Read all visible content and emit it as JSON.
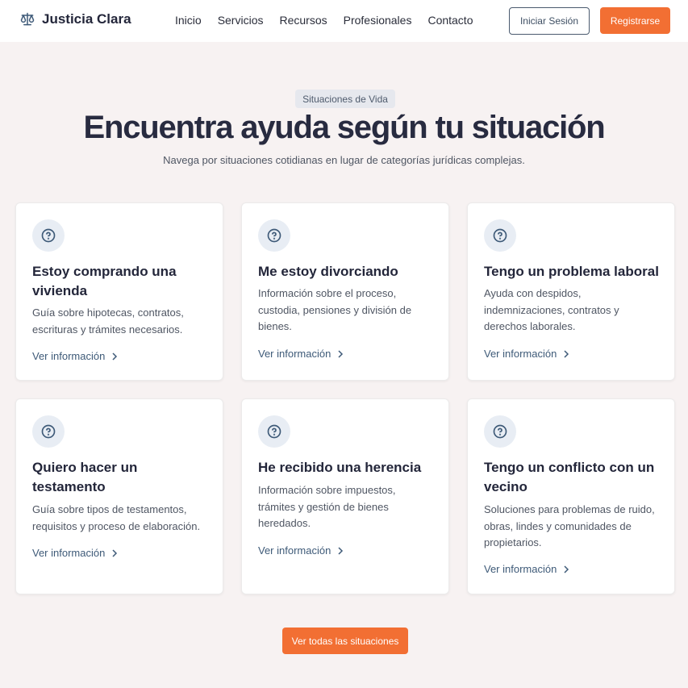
{
  "header": {
    "brand": "Justicia Clara",
    "brand_icon": "scales-icon",
    "nav": [
      "Inicio",
      "Servicios",
      "Recursos",
      "Profesionales",
      "Contacto"
    ],
    "login_label": "Iniciar Sesión",
    "register_label": "Registrarse"
  },
  "hero": {
    "badge": "Situaciones de Vida",
    "title": "Encuentra ayuda según tu situación",
    "subtitle": "Navega por situaciones cotidianas en lugar de categorías jurídicas complejas."
  },
  "cards": [
    {
      "icon": "question-circle-icon",
      "title": "Estoy comprando una vivienda",
      "description": "Guía sobre hipotecas, contratos, escrituras y trámites necesarios.",
      "link": "Ver información"
    },
    {
      "icon": "question-circle-icon",
      "title": "Me estoy divorciando",
      "description": "Información sobre el proceso, custodia, pensiones y división de bienes.",
      "link": "Ver información"
    },
    {
      "icon": "question-circle-icon",
      "title": "Tengo un problema laboral",
      "description": "Ayuda con despidos, indemnizaciones, contratos y derechos laborales.",
      "link": "Ver información"
    },
    {
      "icon": "question-circle-icon",
      "title": "Quiero hacer un testamento",
      "description": "Guía sobre tipos de testamentos, requisitos y proceso de elaboración.",
      "link": "Ver información"
    },
    {
      "icon": "question-circle-icon",
      "title": "He recibido una herencia",
      "description": "Información sobre impuestos, trámites y gestión de bienes heredados.",
      "link": "Ver información"
    },
    {
      "icon": "question-circle-icon",
      "title": "Tengo un conflicto con un vecino",
      "description": "Soluciones para problemas de ruido, obras, lindes y comunidades de propietarios.",
      "link": "Ver información"
    }
  ],
  "cta": {
    "label": "Ver todas las situaciones"
  },
  "colors": {
    "accent": "#f26f33",
    "link": "#3e5a78",
    "background": "#f7f2f2",
    "icon_bg": "#e8edf4"
  }
}
